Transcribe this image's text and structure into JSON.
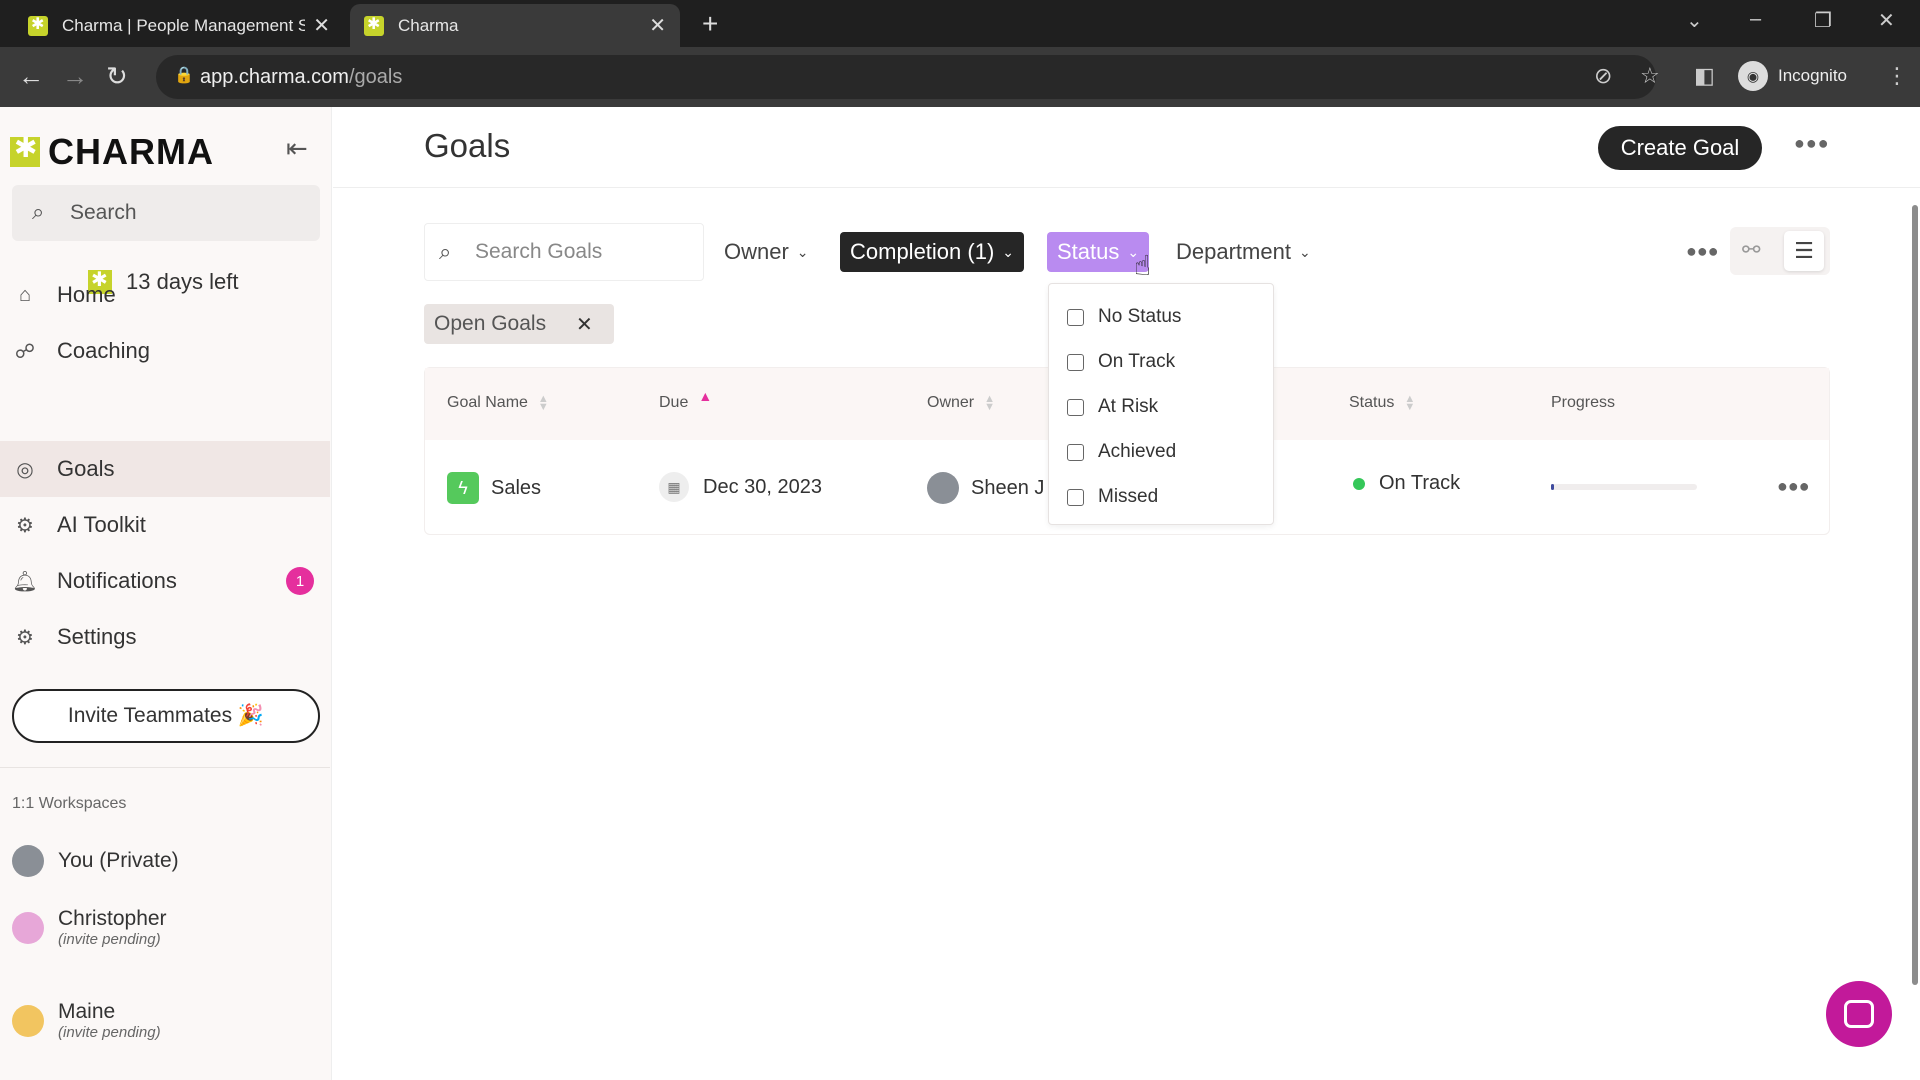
{
  "browser": {
    "tabs": [
      {
        "title": "Charma | People Management S"
      },
      {
        "title": "Charma"
      }
    ],
    "url_host": "app.charma.com",
    "url_path": "/goals",
    "incognito_label": "Incognito"
  },
  "sidebar": {
    "logo": "CHARMA",
    "search_placeholder": "Search",
    "trial_text": "13 days left",
    "nav": [
      {
        "label": "Home",
        "icon": "home-icon"
      },
      {
        "label": "Coaching",
        "icon": "coaching-icon"
      },
      {
        "label": "Goals",
        "icon": "target-icon",
        "active": true
      },
      {
        "label": "AI Toolkit",
        "icon": "robot-icon"
      },
      {
        "label": "Notifications",
        "icon": "bell-icon",
        "badge": "1"
      },
      {
        "label": "Settings",
        "icon": "gear-icon"
      }
    ],
    "invite_label": "Invite Teammates 🎉",
    "workspaces_title": "1:1 Workspaces",
    "workspaces": [
      {
        "name": "You (Private)",
        "sub": ""
      },
      {
        "name": "Christopher",
        "sub": "(invite pending)"
      },
      {
        "name": "Maine",
        "sub": "(invite pending)"
      }
    ]
  },
  "main": {
    "title": "Goals",
    "create_label": "Create Goal",
    "search_placeholder": "Search Goals",
    "filters": {
      "owner": "Owner",
      "completion": "Completion (1)",
      "status": "Status",
      "department": "Department"
    },
    "chip": "Open Goals",
    "columns": {
      "name": "Goal Name",
      "due": "Due",
      "owner": "Owner",
      "status": "Status",
      "progress": "Progress"
    },
    "rows": [
      {
        "name": "Sales",
        "due": "Dec 30, 2023",
        "owner": "Sheen J",
        "status": "On Track",
        "progress": 0.02
      }
    ],
    "status_options": [
      "No Status",
      "On Track",
      "At Risk",
      "Achieved",
      "Missed"
    ]
  },
  "colors": {
    "accent": "#c6d32b",
    "status_filter": "#b98bf0",
    "badge": "#e52f9d",
    "on_track": "#35c759",
    "chat": "#c2199a"
  }
}
